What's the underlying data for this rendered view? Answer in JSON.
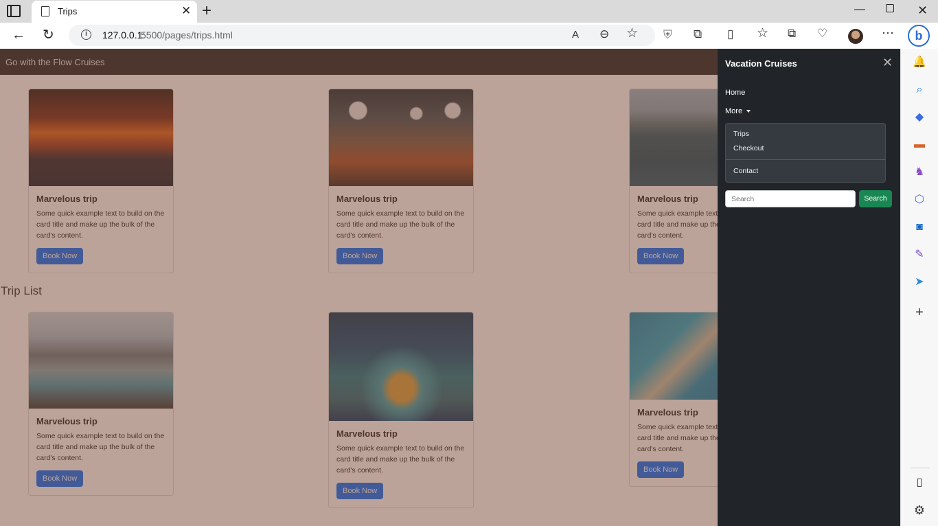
{
  "browser": {
    "tab_title": "Trips",
    "url_host": "127.0.0.1:",
    "url_path": "5500/pages/trips.html"
  },
  "navbar": {
    "brand": "Go with the Flow Cruises"
  },
  "section_heading": "Trip List",
  "cards": [
    {
      "title": "Marvelous trip",
      "text": "Some quick example text to build on the card title and make up the bulk of the card's content.",
      "button": "Book Now"
    },
    {
      "title": "Marvelous trip",
      "text": "Some quick example text to build on the card title and make up the bulk of the card's content.",
      "button": "Book Now"
    },
    {
      "title": "Marvelous trip",
      "text": "Some quick example text to build on the card title and make up the bulk of the card's content.",
      "button": "Book Now"
    },
    {
      "title": "Marvelous trip",
      "text": "Some quick example text to build on the card title and make up the bulk of the card's content.",
      "button": "Book Now"
    },
    {
      "title": "Marvelous trip",
      "text": "Some quick example text to build on the card title and make up the bulk of the card's content.",
      "button": "Book Now"
    },
    {
      "title": "Marvelous trip",
      "text": "Some quick example text to build on the card title and make up the bulk of the card's content.",
      "button": "Book Now"
    }
  ],
  "offcanvas": {
    "title": "Vacation Cruises",
    "home": "Home",
    "more": "More",
    "dropdown": [
      "Trips",
      "Checkout",
      "Contact"
    ],
    "search_placeholder": "Search",
    "search_button": "Search"
  },
  "colors": {
    "navbar_bg": "#212529",
    "primary_button": "#0d6efd",
    "search_button": "#198754",
    "backdrop": "rgba(120,72,52,0.5)"
  },
  "icons": {
    "edge_sidebar": [
      "bell-icon",
      "search-icon",
      "tag-icon",
      "toolbox-icon",
      "games-icon",
      "office-icon",
      "outlook-icon",
      "designer-icon",
      "send-icon",
      "add-icon",
      "sidebar-layout-icon",
      "settings-icon"
    ]
  }
}
